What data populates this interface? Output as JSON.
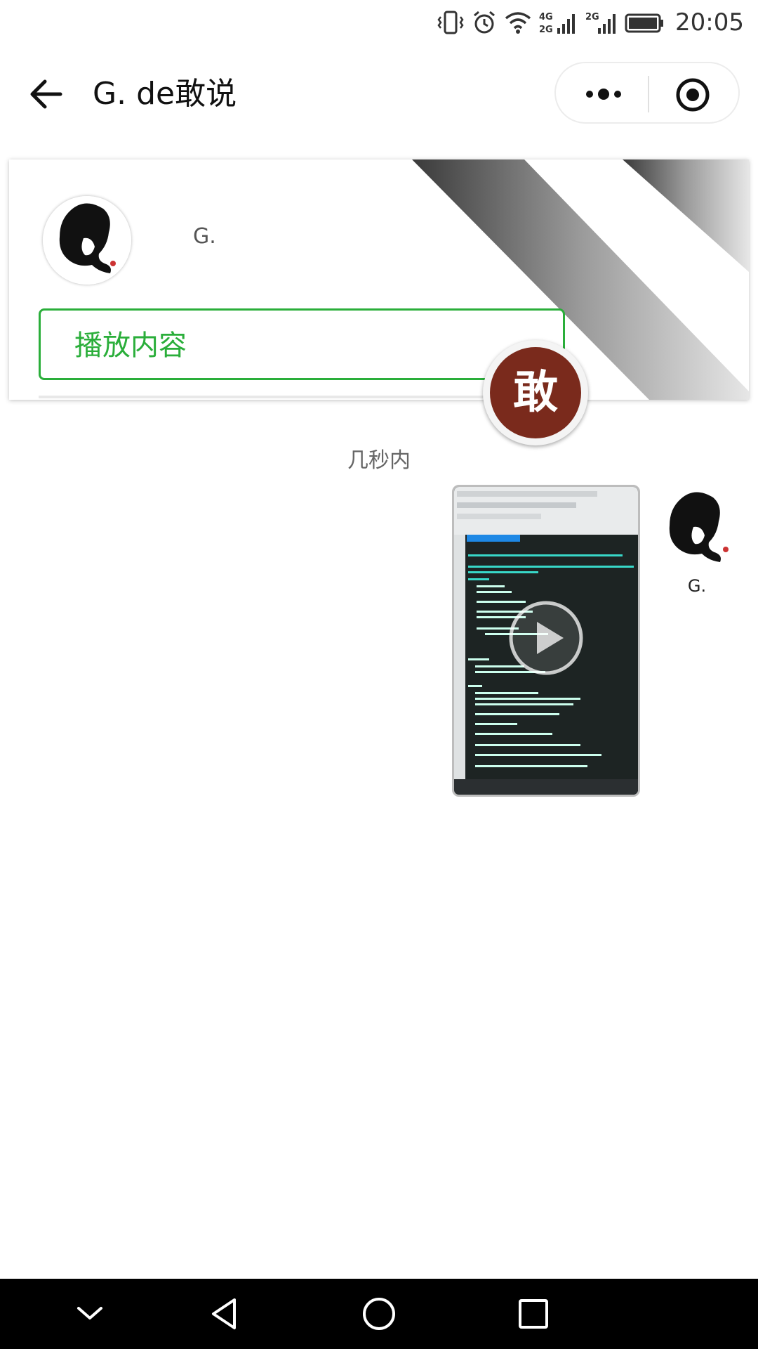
{
  "status_bar": {
    "time": "20:05",
    "icons": [
      "vibrate-icon",
      "alarm-icon",
      "wifi-icon",
      "signal-4g-2g-icon",
      "signal-2g-icon",
      "battery-icon"
    ]
  },
  "nav": {
    "title": "G. de敢说",
    "back_icon": "arrow-left-icon",
    "more_icon": "more-dots-icon",
    "close_icon": "target-icon"
  },
  "profile_card": {
    "name": "G.",
    "play_button_label": "播放内容",
    "badge_char": "敢"
  },
  "chat": {
    "timestamp": "几秒内",
    "messages": [
      {
        "type": "video",
        "sender_name": "G.",
        "play_icon": "play-icon"
      }
    ]
  },
  "system_nav": {
    "buttons": [
      "chevron-down-icon",
      "back-triangle-icon",
      "home-circle-icon",
      "recents-square-icon"
    ]
  },
  "colors": {
    "accent_green": "#2aae3a",
    "badge_brown": "#7a2a1c",
    "system_bar": "#000000"
  }
}
